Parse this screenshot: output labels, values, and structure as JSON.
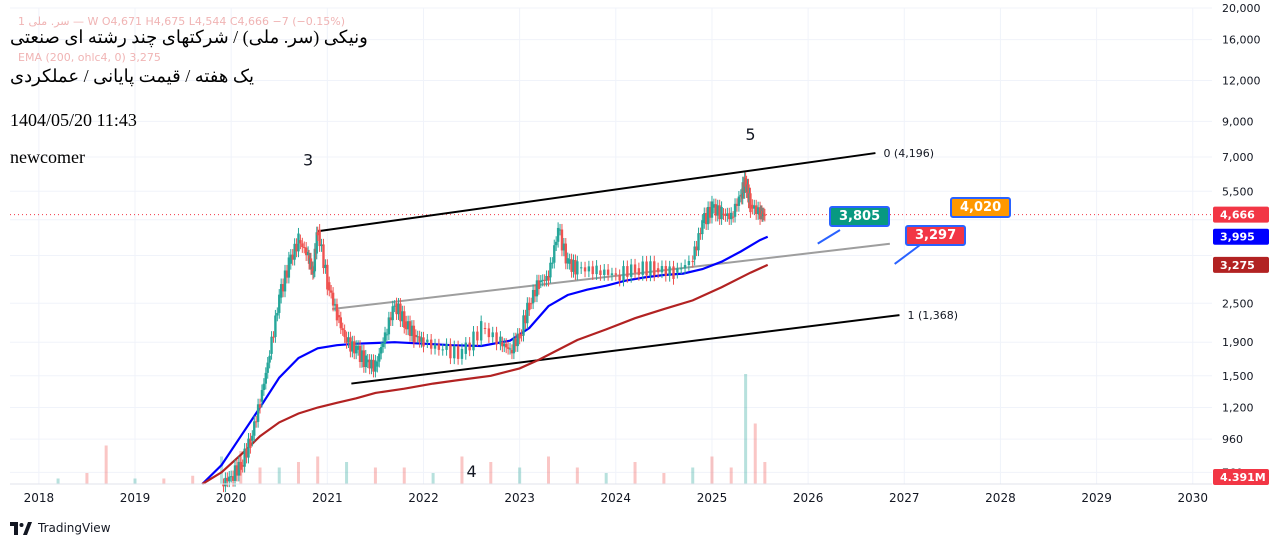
{
  "header": {
    "line1": "ونیکی (سر. ملی) / شرکتهای چند رشته ای صنعتی",
    "line2": "یک هفته / قیمت پایانی / عملکردی",
    "datetime": "1404/05/20 11:43",
    "author": "newcomer",
    "faint_ohlc": "1  سر. ملی — W  O4,671  H4,675  L4,544  C4,666  −7 (−0.15%)",
    "faint_ema": "EMA (200, ohlc4, 0)  3,275"
  },
  "footer": {
    "brand": "TradingView",
    "logo_icon": "tradingview-logo-icon"
  },
  "chart_data": {
    "type": "line",
    "scale": "log",
    "ylim": [
      700,
      20000
    ],
    "xlim": [
      2017.7,
      2030.2
    ],
    "y_ticks": [
      "20,000",
      "16,000",
      "12,000",
      "9,000",
      "7,000",
      "5,500",
      "4,666",
      "3,995",
      "3,275",
      "2,500",
      "1,900",
      "1,500",
      "1,200",
      "960",
      "760"
    ],
    "y_tick_values": [
      20000,
      16000,
      12000,
      9000,
      7000,
      5500,
      4500,
      3500,
      2500,
      1900,
      1500,
      1200,
      960,
      760
    ],
    "x_ticks": [
      "2018",
      "2019",
      "2020",
      "2021",
      "2022",
      "2023",
      "2024",
      "2025",
      "2026",
      "2027",
      "2028",
      "2029",
      "2030"
    ],
    "x_tick_values": [
      2018,
      2019,
      2020,
      2021,
      2022,
      2023,
      2024,
      2025,
      2026,
      2027,
      2028,
      2029,
      2030
    ],
    "price_labels": [
      {
        "text": "4,666",
        "value": 4666,
        "color": "#f23645"
      },
      {
        "text": "3,995",
        "value": 3995,
        "color": "#0000ff"
      },
      {
        "text": "3,275",
        "value": 3275,
        "color": "#b22222"
      },
      {
        "text": "4.391M",
        "value": 700,
        "color": "#f23645"
      }
    ],
    "close_series": {
      "x": [
        2019.9,
        2020.0,
        2020.1,
        2020.2,
        2020.3,
        2020.4,
        2020.5,
        2020.6,
        2020.7,
        2020.8,
        2020.85,
        2020.9,
        2021.0,
        2021.1,
        2021.2,
        2021.3,
        2021.4,
        2021.5,
        2021.6,
        2021.7,
        2021.8,
        2021.9,
        2022.0,
        2022.2,
        2022.4,
        2022.6,
        2022.8,
        2022.9,
        2023.0,
        2023.1,
        2023.2,
        2023.3,
        2023.4,
        2023.5,
        2023.6,
        2023.8,
        2024.0,
        2024.2,
        2024.4,
        2024.6,
        2024.8,
        2024.9,
        2025.0,
        2025.1,
        2025.2,
        2025.3,
        2025.35,
        2025.4,
        2025.5,
        2025.55
      ],
      "y": [
        700,
        740,
        800,
        950,
        1250,
        1750,
        2600,
        3300,
        3900,
        3500,
        3100,
        4200,
        2900,
        2300,
        1900,
        1800,
        1650,
        1600,
        2000,
        2500,
        2200,
        2000,
        1900,
        1800,
        1750,
        2100,
        1900,
        1800,
        2000,
        2500,
        2900,
        3000,
        4200,
        3300,
        3200,
        3150,
        3050,
        3200,
        3200,
        3100,
        3400,
        4400,
        4900,
        4700,
        4600,
        5400,
        5900,
        5000,
        4700,
        4666
      ]
    },
    "series": [
      {
        "name": "",
        "color": "#0000ff",
        "x": [
          2019.7,
          2019.9,
          2020.1,
          2020.3,
          2020.5,
          2020.7,
          2020.9,
          2021.1,
          2021.3,
          2021.5,
          2021.7,
          2022.0,
          2022.3,
          2022.6,
          2022.9,
          2023.1,
          2023.3,
          2023.5,
          2023.7,
          2023.9,
          2024.1,
          2024.3,
          2024.5,
          2024.7,
          2024.9,
          2025.1,
          2025.3,
          2025.5,
          2025.58
        ],
        "y": [
          700,
          800,
          980,
          1200,
          1480,
          1700,
          1820,
          1860,
          1880,
          1890,
          1900,
          1880,
          1860,
          1850,
          1920,
          2100,
          2450,
          2650,
          2750,
          2830,
          2930,
          3000,
          3050,
          3080,
          3180,
          3350,
          3600,
          3900,
          3995
        ]
      },
      {
        "name": "",
        "color": "#b22222",
        "x": [
          2019.7,
          2019.9,
          2020.1,
          2020.3,
          2020.5,
          2020.7,
          2020.9,
          2021.1,
          2021.3,
          2021.5,
          2021.8,
          2022.1,
          2022.4,
          2022.7,
          2023.0,
          2023.2,
          2023.4,
          2023.6,
          2023.9,
          2024.2,
          2024.5,
          2024.8,
          2025.1,
          2025.4,
          2025.58
        ],
        "y": [
          700,
          760,
          860,
          980,
          1080,
          1150,
          1200,
          1240,
          1280,
          1330,
          1370,
          1420,
          1460,
          1500,
          1580,
          1680,
          1800,
          1930,
          2080,
          2250,
          2400,
          2550,
          2800,
          3100,
          3275
        ]
      }
    ],
    "volume_bars": {
      "x": [
        2018.2,
        2018.5,
        2018.7,
        2019.0,
        2019.3,
        2019.6,
        2019.9,
        2020.1,
        2020.3,
        2020.5,
        2020.7,
        2020.9,
        2021.2,
        2021.5,
        2021.8,
        2022.1,
        2022.4,
        2022.7,
        2023.0,
        2023.3,
        2023.6,
        2023.9,
        2024.2,
        2024.5,
        2024.8,
        2025.0,
        2025.2,
        2025.35,
        2025.45,
        2025.55
      ],
      "v": [
        0.1,
        0.2,
        0.7,
        0.1,
        0.1,
        0.15,
        0.5,
        0.6,
        0.3,
        0.3,
        0.4,
        0.5,
        0.4,
        0.3,
        0.3,
        0.2,
        0.5,
        0.4,
        0.3,
        0.5,
        0.3,
        0.2,
        0.4,
        0.2,
        0.3,
        0.5,
        0.3,
        2.0,
        1.1,
        0.4
      ]
    },
    "trend_lines": [
      {
        "label": "0 (4,196)",
        "color": "#000000",
        "x": [
          2020.9,
          2026.7
        ],
        "y": [
          4150,
          7200
        ]
      },
      {
        "label": "1 (1,368)",
        "color": "#000000",
        "x": [
          2021.25,
          2026.95
        ],
        "y": [
          1420,
          2300
        ]
      },
      {
        "label": "",
        "color": "#9e9e9e",
        "x": [
          2021.05,
          2026.85
        ],
        "y": [
          2400,
          3800
        ]
      }
    ],
    "wave_labels": [
      {
        "text": "3",
        "x": 2020.8,
        "y": 6600
      },
      {
        "text": "5",
        "x": 2025.4,
        "y": 7900
      },
      {
        "text": "4",
        "x": 2022.5,
        "y": 735
      }
    ],
    "callouts": [
      {
        "text": "3,805",
        "value": 3805,
        "color": "#089981"
      },
      {
        "text": "4,020",
        "value": 4020,
        "color": "#ff9800"
      },
      {
        "text": "3,297",
        "value": 3297,
        "color": "#f23645"
      }
    ]
  }
}
